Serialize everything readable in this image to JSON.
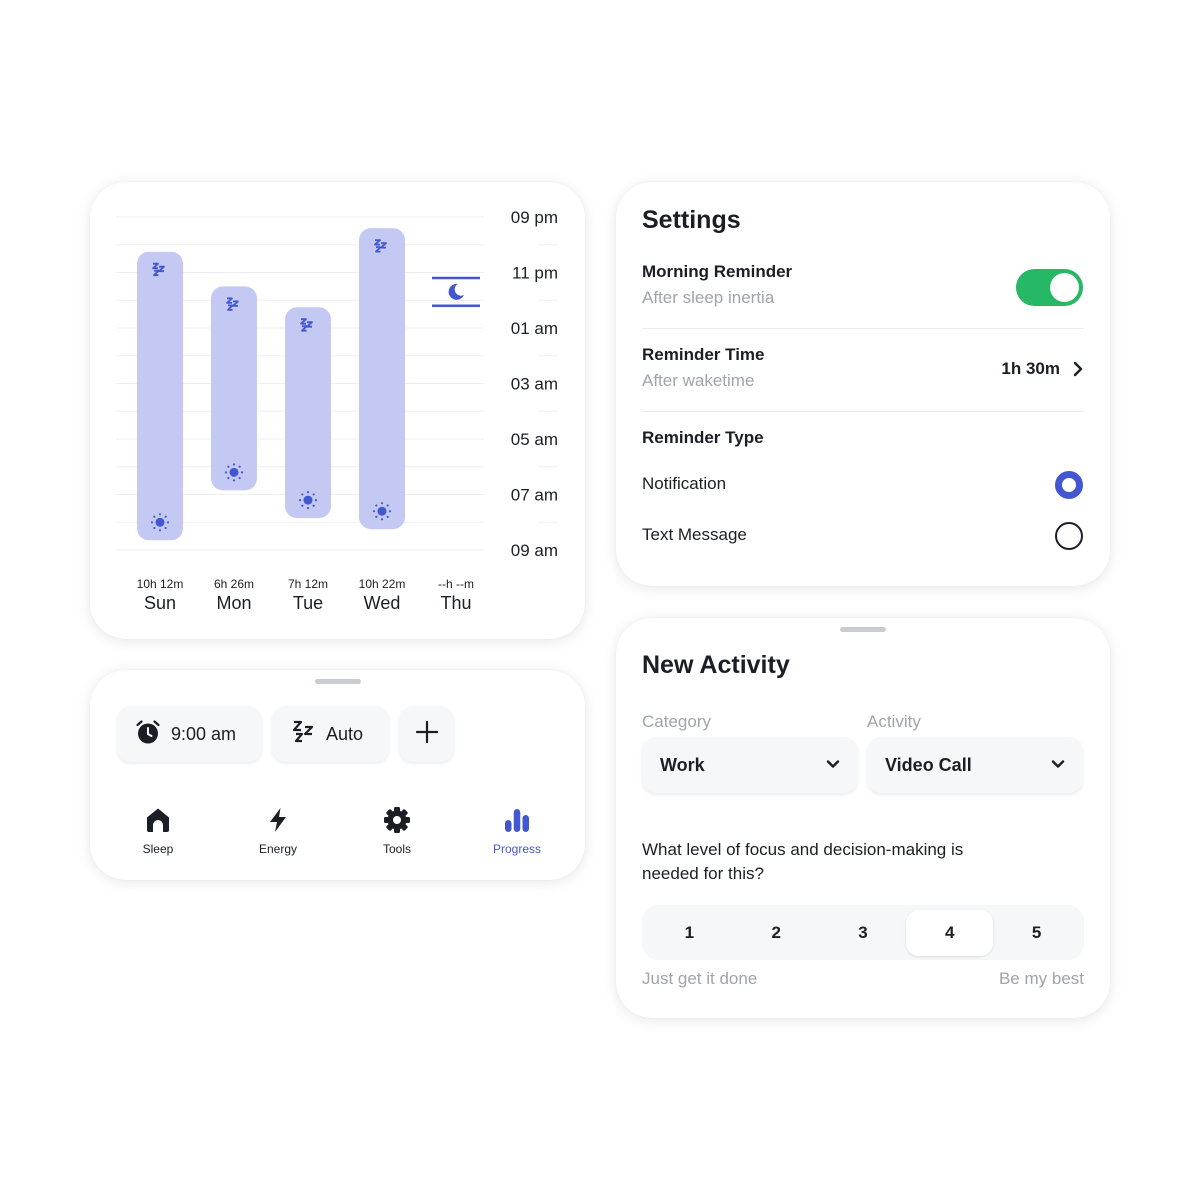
{
  "chart_data": {
    "type": "range-bar",
    "title": "",
    "y_axis": {
      "labels": [
        "09 pm",
        "11 pm",
        "01 am",
        "03 am",
        "05 am",
        "07 am",
        "09 am"
      ],
      "range_hours_from_9pm": [
        0,
        12
      ],
      "grid": true
    },
    "categories": [
      "Sun",
      "Mon",
      "Tue",
      "Wed",
      "Thu"
    ],
    "durations": [
      "10h 12m",
      "6h 26m",
      "7h 12m",
      "10h 22m",
      "--h --m"
    ],
    "series": [
      {
        "name": "Sleep",
        "color": "#c3c9f2",
        "icon_color": "#4358d0",
        "start_icon": "zzz-icon",
        "end_icon": "sun-icon",
        "values": [
          {
            "day": "Sun",
            "bedtime": "10:15 pm",
            "wake": "8:40 am",
            "start_h": 1.25,
            "end_h": 11.65
          },
          {
            "day": "Mon",
            "bedtime": "11:30 pm",
            "wake": "6:50 am",
            "start_h": 2.5,
            "end_h": 9.85
          },
          {
            "day": "Tue",
            "bedtime": "12:15 am",
            "wake": "7:50 am",
            "start_h": 3.25,
            "end_h": 10.85
          },
          {
            "day": "Wed",
            "bedtime": "9:25 pm",
            "wake": "8:15 am",
            "start_h": 0.4,
            "end_h": 11.25
          }
        ]
      }
    ],
    "pending": {
      "day": "Thu",
      "icon": "moon-icon",
      "start_h": 2.2,
      "end_h": 3.2
    }
  },
  "controls": {
    "alarm_label": "9:00 am",
    "mode_label": "Auto",
    "add_label": "+"
  },
  "nav": {
    "items": [
      {
        "label": "Sleep",
        "icon": "home-icon",
        "active": false
      },
      {
        "label": "Energy",
        "icon": "bolt-icon",
        "active": false
      },
      {
        "label": "Tools",
        "icon": "gear-icon",
        "active": false
      },
      {
        "label": "Progress",
        "icon": "bar-chart-icon",
        "active": true
      }
    ],
    "active_color": "#4358d0"
  },
  "settings": {
    "title": "Settings",
    "morning_reminder": {
      "title": "Morning Reminder",
      "subtitle": "After sleep inertia",
      "enabled": true
    },
    "reminder_time": {
      "title": "Reminder Time",
      "subtitle": "After waketime",
      "value": "1h 30m"
    },
    "reminder_type": {
      "title": "Reminder Type",
      "options": [
        {
          "label": "Notification",
          "selected": true
        },
        {
          "label": "Text Message",
          "selected": false
        }
      ]
    },
    "toggle_color": "#27b866"
  },
  "activity": {
    "title": "New Activity",
    "category": {
      "label": "Category",
      "value": "Work"
    },
    "activity": {
      "label": "Activity",
      "value": "Video Call"
    },
    "question": "What level of focus and decision-making is needed for this?",
    "scale": {
      "options": [
        "1",
        "2",
        "3",
        "4",
        "5"
      ],
      "selected": "4"
    },
    "scale_min_label": "Just get it done",
    "scale_max_label": "Be my best"
  }
}
